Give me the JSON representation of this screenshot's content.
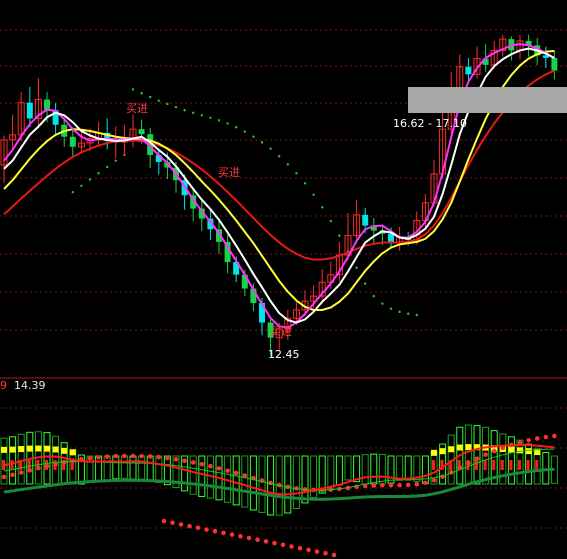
{
  "chart_data": [
    {
      "type": "candlestick",
      "panel": "price",
      "colors": {
        "up": "#ff2b2b",
        "down": "#00e5e5",
        "down_alt": "#17d34a",
        "ma_white": "#ffffff",
        "ma_magenta": "#ff33ff",
        "ma_yellow": "#ffff33",
        "ma_red": "#e81818",
        "sar": "#22cc22"
      },
      "annotations": {
        "low_label": "12.45",
        "range_label": "16.62 - 17.10",
        "buy_label_1": "买进",
        "buy_label_2": "买进",
        "buy_label_3": "买进"
      },
      "grid": true,
      "candles": [
        [
          15.48,
          15.88,
          15.2,
          15.95
        ],
        [
          15.88,
          15.96,
          15.7,
          16.28
        ],
        [
          15.96,
          16.47,
          15.86,
          16.64
        ],
        [
          16.47,
          16.22,
          16.08,
          16.72
        ],
        [
          16.22,
          16.52,
          16.1,
          16.86
        ],
        [
          16.52,
          16.35,
          16.16,
          16.64
        ],
        [
          16.35,
          16.12,
          15.94,
          16.46
        ],
        [
          16.12,
          15.93,
          15.77,
          16.24
        ],
        [
          15.93,
          15.77,
          15.62,
          16.08
        ],
        [
          15.77,
          15.83,
          15.66,
          16.01
        ],
        [
          15.83,
          15.9,
          15.7,
          16.06
        ],
        [
          15.9,
          15.99,
          15.79,
          16.17
        ],
        [
          15.99,
          15.86,
          15.73,
          16.22
        ],
        [
          15.86,
          15.87,
          15.59,
          16.09
        ],
        [
          15.87,
          15.87,
          15.63,
          16.12
        ],
        [
          15.87,
          16.05,
          15.76,
          16.28
        ],
        [
          16.05,
          15.97,
          15.82,
          16.2
        ],
        [
          15.97,
          15.64,
          15.43,
          16.07
        ],
        [
          15.64,
          15.53,
          15.33,
          15.74
        ],
        [
          15.53,
          15.44,
          15.26,
          15.68
        ],
        [
          15.44,
          15.24,
          15.04,
          15.53
        ],
        [
          15.24,
          15.0,
          14.77,
          15.33
        ],
        [
          15.0,
          14.79,
          14.59,
          15.13
        ],
        [
          14.79,
          14.63,
          14.43,
          14.92
        ],
        [
          14.63,
          14.46,
          14.29,
          14.79
        ],
        [
          14.46,
          14.26,
          14.07,
          14.6
        ],
        [
          14.26,
          13.94,
          13.76,
          14.37
        ],
        [
          13.94,
          13.74,
          13.62,
          14.03
        ],
        [
          13.74,
          13.52,
          13.4,
          13.82
        ],
        [
          13.52,
          13.29,
          13.16,
          13.6
        ],
        [
          13.29,
          12.98,
          12.78,
          13.37
        ],
        [
          12.98,
          12.74,
          12.45,
          13.07
        ],
        [
          12.74,
          12.88,
          12.55,
          12.98
        ],
        [
          12.88,
          13.05,
          12.7,
          13.18
        ],
        [
          13.05,
          13.18,
          12.94,
          13.33
        ],
        [
          13.18,
          13.32,
          13.08,
          13.49
        ],
        [
          13.32,
          13.4,
          13.21,
          13.57
        ],
        [
          13.4,
          13.62,
          13.28,
          13.83
        ],
        [
          13.62,
          13.74,
          13.51,
          13.95
        ],
        [
          13.74,
          14.05,
          13.63,
          14.26
        ],
        [
          14.05,
          14.36,
          13.97,
          14.72
        ],
        [
          14.36,
          14.69,
          14.24,
          14.92
        ],
        [
          14.69,
          14.52,
          14.4,
          14.8
        ],
        [
          14.52,
          14.44,
          14.22,
          14.64
        ],
        [
          14.44,
          14.39,
          14.21,
          14.53
        ],
        [
          14.39,
          14.25,
          14.15,
          14.49
        ],
        [
          14.25,
          14.34,
          14.12,
          14.5
        ],
        [
          14.34,
          14.29,
          14.2,
          14.42
        ],
        [
          14.29,
          14.6,
          14.22,
          14.74
        ],
        [
          14.6,
          14.88,
          14.49,
          15.02
        ],
        [
          14.88,
          15.34,
          14.82,
          15.56
        ],
        [
          15.34,
          16.05,
          15.26,
          16.31
        ],
        [
          16.05,
          16.68,
          15.96,
          16.96
        ],
        [
          16.68,
          17.04,
          16.61,
          17.24
        ],
        [
          17.04,
          16.92,
          16.8,
          17.18
        ],
        [
          16.92,
          17.17,
          16.85,
          17.36
        ],
        [
          17.17,
          17.07,
          16.96,
          17.4
        ],
        [
          17.07,
          17.3,
          17.01,
          17.45
        ],
        [
          17.3,
          17.48,
          17.2,
          17.55
        ],
        [
          17.48,
          17.3,
          17.14,
          17.52
        ],
        [
          17.3,
          17.45,
          17.16,
          17.54
        ],
        [
          17.45,
          17.38,
          17.2,
          17.55
        ],
        [
          17.38,
          17.22,
          17.07,
          17.5
        ],
        [
          17.22,
          17.18,
          17.02,
          17.36
        ],
        [
          17.18,
          16.98,
          16.84,
          17.3
        ]
      ],
      "moving_averages": {
        "white": [
          15.42,
          15.55,
          15.76,
          15.96,
          16.09,
          16.24,
          16.31,
          16.27,
          16.16,
          16.02,
          15.95,
          15.9,
          15.88,
          15.86,
          15.87,
          15.9,
          15.93,
          15.84,
          15.72,
          15.61,
          15.46,
          15.28,
          15.1,
          14.93,
          14.78,
          14.61,
          14.41,
          14.2,
          13.98,
          13.75,
          13.54,
          13.32,
          13.13,
          13.02,
          12.98,
          13.03,
          13.15,
          13.31,
          13.44,
          13.58,
          13.79,
          14.02,
          14.25,
          14.35,
          14.43,
          14.41,
          14.33,
          14.31,
          14.37,
          14.47,
          14.66,
          15.02,
          15.48,
          15.97,
          16.33,
          16.61,
          16.88,
          17.05,
          17.16,
          17.24,
          17.3,
          17.33,
          17.3,
          17.25,
          17.18
        ],
        "magenta": [
          15.55,
          15.72,
          15.94,
          16.13,
          16.27,
          16.36,
          16.34,
          16.21,
          16.05,
          15.93,
          15.87,
          15.89,
          15.9,
          15.89,
          15.88,
          15.91,
          15.9,
          15.77,
          15.64,
          15.51,
          15.34,
          15.14,
          14.93,
          14.75,
          14.58,
          14.4,
          14.18,
          13.96,
          13.74,
          13.5,
          13.27,
          13.05,
          12.92,
          12.9,
          12.98,
          13.12,
          13.28,
          13.44,
          13.6,
          13.79,
          14.02,
          14.28,
          14.46,
          14.51,
          14.52,
          14.43,
          14.33,
          14.33,
          14.42,
          14.58,
          14.88,
          15.36,
          15.92,
          16.46,
          16.8,
          17.02,
          17.18,
          17.26,
          17.32,
          17.38,
          17.4,
          17.38,
          17.33,
          17.26,
          17.17
        ],
        "yellow": [
          15.1,
          15.24,
          15.41,
          15.58,
          15.73,
          15.86,
          15.96,
          16.02,
          16.05,
          16.04,
          16.02,
          15.99,
          15.96,
          15.93,
          15.91,
          15.9,
          15.89,
          15.87,
          15.82,
          15.74,
          15.64,
          15.51,
          15.37,
          15.22,
          15.08,
          14.93,
          14.77,
          14.6,
          14.42,
          14.24,
          14.04,
          13.84,
          13.64,
          13.47,
          13.33,
          13.23,
          13.18,
          13.18,
          13.22,
          13.31,
          13.44,
          13.62,
          13.8,
          13.95,
          14.08,
          14.17,
          14.22,
          14.24,
          14.26,
          14.31,
          14.43,
          14.62,
          14.88,
          15.22,
          15.57,
          15.9,
          16.21,
          16.48,
          16.72,
          16.91,
          17.06,
          17.17,
          17.24,
          17.28,
          17.29
        ],
        "red": [
          14.7,
          14.82,
          14.95,
          15.07,
          15.19,
          15.31,
          15.42,
          15.52,
          15.61,
          15.68,
          15.74,
          15.79,
          15.83,
          15.86,
          15.87,
          15.87,
          15.86,
          15.84,
          15.8,
          15.75,
          15.68,
          15.6,
          15.51,
          15.41,
          15.3,
          15.18,
          15.05,
          14.92,
          14.78,
          14.64,
          14.5,
          14.37,
          14.25,
          14.15,
          14.07,
          14.01,
          13.98,
          13.98,
          14.0,
          14.04,
          14.09,
          14.15,
          14.2,
          14.23,
          14.25,
          14.25,
          14.25,
          14.26,
          14.3,
          14.38,
          14.52,
          14.72,
          14.96,
          15.22,
          15.48,
          15.72,
          15.94,
          16.14,
          16.32,
          16.48,
          16.62,
          16.74,
          16.84,
          16.92,
          16.98
        ]
      },
      "sar": [
        15.05,
        15.15,
        15.25,
        15.35,
        15.45,
        15.55,
        15.64,
        16.68,
        16.62,
        16.56,
        16.5,
        16.45,
        16.4,
        16.35,
        16.31,
        16.27,
        16.23,
        16.19,
        16.14,
        16.08,
        16.01,
        15.93,
        15.84,
        15.74,
        15.62,
        15.49,
        15.35,
        15.19,
        15.01,
        14.81,
        14.59,
        14.36,
        14.11,
        13.85,
        13.6,
        13.4,
        13.28,
        13.2,
        13.15,
        13.12,
        13.1
      ]
    },
    {
      "type": "indicator",
      "panel": "lower",
      "header_prefix": "9",
      "header_value": "14.39",
      "colors": {
        "yellow_bar": "#ffff00",
        "red_bar": "#ff1a1a",
        "hist_green": "#33ff33",
        "hist_green_dim": "#1f9e1f",
        "line_green": "#23c023",
        "line_dark_green": "#1a8a3a",
        "dots": "#ff3030"
      }
    }
  ]
}
